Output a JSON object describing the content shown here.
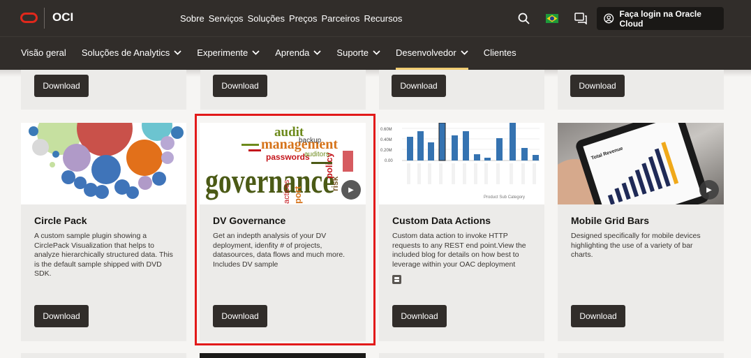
{
  "header": {
    "logo_text": "OCI",
    "nav": [
      "Sobre",
      "Serviços",
      "Soluções",
      "Preços",
      "Parceiros",
      "Recursos"
    ],
    "login_label": "Faça login na Oracle Cloud",
    "icons": [
      "search-icon",
      "brazil-flag-icon",
      "chat-icon",
      "user-icon"
    ]
  },
  "subnav": {
    "items": [
      {
        "label": "Visão geral"
      },
      {
        "label": "Soluções de Analytics",
        "chevron": "⌄"
      },
      {
        "label": "Experimente",
        "chevron": "⌄"
      },
      {
        "label": "Aprenda",
        "chevron": "⌄"
      },
      {
        "label": "Suporte",
        "chevron": "⌄"
      },
      {
        "label": "Desenvolvedor",
        "chevron": "⌄"
      },
      {
        "label": "Clientes"
      }
    ],
    "active": "Desenvolvedor"
  },
  "download_label": "Download",
  "cards": [
    {
      "title": "Circle Pack",
      "description": "A custom sample plugin showing a CirclePack Visualization that helps to analyze hierarchically structured data. This is the default sample shipped with DVD SDK."
    },
    {
      "title": "DV Governance",
      "description": "Get an indepth analysis of your DV deployment, idenfity # of projects, datasources, data flows and much more. Includes DV sample",
      "highlighted": true
    },
    {
      "title": "Custom Data Actions",
      "description": "Custom data action to invoke HTTP requests to any REST end point.View the included blog for details on how best to leverage within your OAC deployment"
    },
    {
      "title": "Mobile Grid Bars",
      "description": "Designed specifically for mobile devices highlighting the use of a variety of bar charts."
    }
  ],
  "thumbnail_text": {
    "governance_words": [
      "audit",
      "management",
      "governance",
      "passwords",
      "backup",
      "policy",
      "risk",
      "auditors",
      "actices",
      "port"
    ],
    "data_actions_ticks": [
      "0.60M",
      "0.40M",
      "0.20M",
      "0.00"
    ],
    "data_actions_xlabel": "Product Sub Category",
    "mobile_title": "Total Revenue"
  },
  "colors": {
    "header_bg": "#312d2a",
    "accent_underline": "#f0cc71",
    "highlight_border": "#e21a1a",
    "button_bg": "#312d2a"
  }
}
